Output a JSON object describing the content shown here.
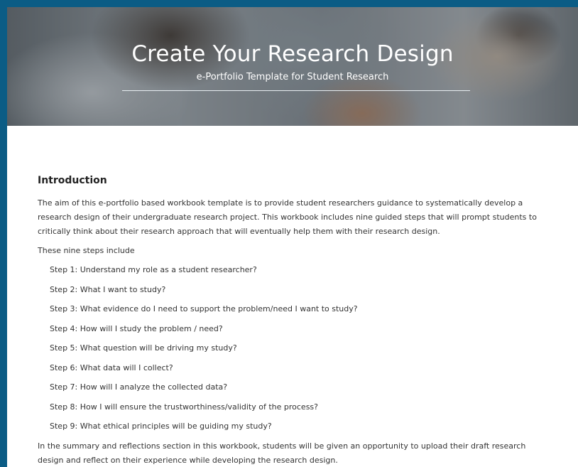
{
  "header": {
    "title": "Create Your Research Design",
    "subtitle": "e-Portfolio Template for Student Research"
  },
  "intro": {
    "heading": "Introduction",
    "paragraph": "The aim of this e-portfolio based workbook template is to provide student researchers guidance to systematically develop a research design of their undergraduate research project. This workbook includes nine guided steps that will prompt students to critically think about their research approach that will eventually help them with their research design.",
    "steps_lead": "These nine steps include",
    "steps": [
      "Step 1: Understand my role as a student researcher?",
      "Step 2: What I want to study?",
      "Step 3: What evidence do I need to support the problem/need I want to study?",
      "Step 4: How will I study the problem / need?",
      "Step 5: What question will be driving my study?",
      "Step 6: What data will I collect?",
      "Step 7: How will I analyze the collected data?",
      "Step 8: How I will ensure the trustworthiness/validity of the process?",
      "Step 9: What ethical principles will be guiding my study?"
    ],
    "summary": "In the summary and reflections section in this workbook, students will be given an opportunity to upload their draft research design and reflect on their experience while developing the research design."
  },
  "colors": {
    "page_border": "#0b5c85",
    "background": "#ffffff",
    "text": "#333333"
  }
}
